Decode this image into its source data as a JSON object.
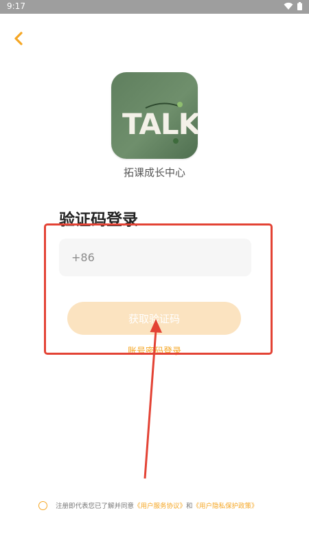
{
  "status_bar": {
    "time": "9:17"
  },
  "app": {
    "name": "拓课成长中心",
    "logo_text": "TALK"
  },
  "login": {
    "title": "验证码登录",
    "country_code": "+86",
    "phone_value": "",
    "get_code_label": "获取验证码",
    "password_login_label": "账号密码登录"
  },
  "agreement": {
    "prefix": "注册即代表您已了解并同意",
    "user_agreement": "《用户服务协议》",
    "conjunction": "和",
    "privacy_policy": "《用户隐私保护政策》"
  },
  "colors": {
    "accent": "#f5a623",
    "button_bg": "#fbe3c0",
    "annotation": "#e34234",
    "logo_green": "#6f8f6c"
  }
}
